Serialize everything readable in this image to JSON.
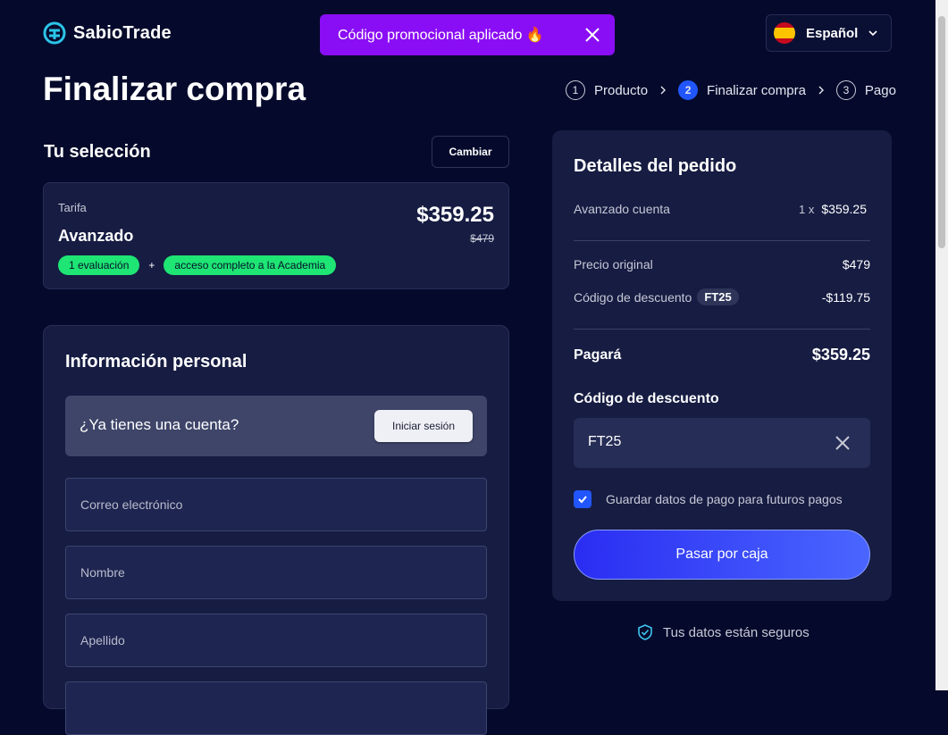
{
  "brand": {
    "name": "SabioTrade"
  },
  "toast": {
    "text": "Código promocional aplicado 🔥"
  },
  "language": {
    "label": "Español"
  },
  "page": {
    "title": "Finalizar compra"
  },
  "steps": [
    {
      "num": "1",
      "label": "Producto"
    },
    {
      "num": "2",
      "label": "Finalizar compra"
    },
    {
      "num": "3",
      "label": "Pago"
    }
  ],
  "selection": {
    "title": "Tu selección",
    "change_label": "Cambiar",
    "plan_label": "Tarifa",
    "plan_name": "Avanzado",
    "price": "$359.25",
    "old_price": "$479",
    "tags": [
      "1 evaluación",
      "acceso completo a la Academia"
    ],
    "plus": "+"
  },
  "personal": {
    "title": "Información personal",
    "account_question": "¿Ya tienes una cuenta?",
    "login_label": "Iniciar sesión",
    "email_placeholder": "Correo electrónico",
    "first_name_placeholder": "Nombre",
    "last_name_placeholder": "Apellido"
  },
  "order": {
    "title": "Detalles del pedido",
    "item_name": "Avanzado cuenta",
    "item_qty": "1 x",
    "item_price": "$359.25",
    "original_label": "Precio original",
    "original_value": "$479",
    "discount_label": "Código de descuento",
    "discount_code": "FT25",
    "discount_value": "-$119.75",
    "pay_label": "Pagará",
    "pay_value": "$359.25",
    "code_section_title": "Código de descuento",
    "code_input_value": "FT25",
    "save_label": "Guardar datos de pago para futuros pagos",
    "save_checked": true,
    "checkout_label": "Pasar por caja"
  },
  "secure": {
    "text": "Tus datos están seguros"
  },
  "colors": {
    "background": "#050a2c",
    "accent": "#2156ff",
    "toast": "#8a0ef5",
    "tag": "#1ee574"
  }
}
